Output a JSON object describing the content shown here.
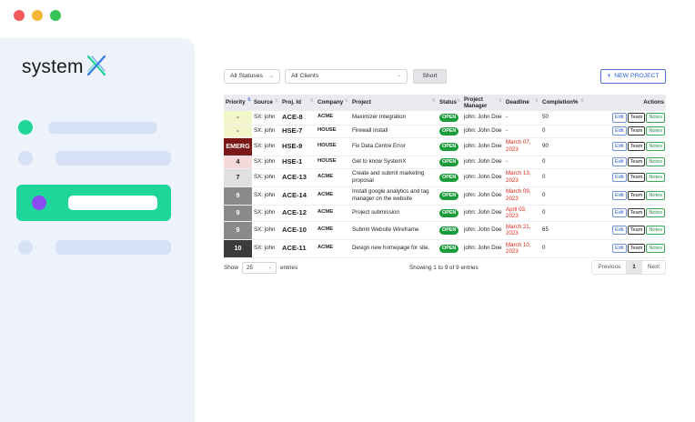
{
  "window": {
    "dots": [
      {
        "name": "close-dot",
        "color": "#f05a5a"
      },
      {
        "name": "minimize-dot",
        "color": "#f6b636"
      },
      {
        "name": "maximize-dot",
        "color": "#38c457"
      }
    ]
  },
  "sidebar": {
    "logo_text": "system",
    "logo_colors": {
      "left": "#1fd69a",
      "right": "#2f7de0"
    },
    "bullets": {
      "green": "#1fd69a",
      "purple": "#8a4cf0",
      "pale": "#d7e1f5"
    }
  },
  "filters": {
    "status_select": "All Statuses",
    "clients_select": "All Clients",
    "short_button": "Short",
    "new_project_button": "NEW PROJECT"
  },
  "table": {
    "headers": {
      "priority": "Priority",
      "source": "Source",
      "proj_id": "Proj. Id",
      "company": "Company",
      "project": "Project",
      "status": "Status",
      "pm": "Project Manager",
      "deadline": "Deadline",
      "completion": "Completion%",
      "actions": "Actions"
    },
    "action_labels": {
      "edit": "Edit",
      "team": "Team",
      "notes": "Notes"
    },
    "rows": [
      {
        "priority": "-",
        "priority_bg": "#f2f6c8",
        "priority_color": "#222",
        "source": "SX: john",
        "proj_id": "ACE-8",
        "company": "ACME",
        "project": "Maximizer Integration",
        "status": "OPEN",
        "pm": "john: John Doe",
        "deadline": "-",
        "deadline_red": false,
        "completion": "50"
      },
      {
        "priority": "-",
        "priority_bg": "#f2f6c8",
        "priority_color": "#222",
        "source": "SX: john",
        "proj_id": "HSE-7",
        "company": "HOUSE",
        "project": "Firewall Install",
        "status": "OPEN",
        "pm": "john: John Doe",
        "deadline": "-",
        "deadline_red": false,
        "completion": "0"
      },
      {
        "priority": "EMERG",
        "priority_bg": "#7b1717",
        "priority_color": "#ffffff",
        "source": "SX: john",
        "proj_id": "HSE-9",
        "company": "HOUSE",
        "project": "Fix Data Centre Error",
        "status": "OPEN",
        "pm": "john: John Doe",
        "deadline": "March 07, 2023",
        "deadline_red": true,
        "completion": "90"
      },
      {
        "priority": "4",
        "priority_bg": "#f6dada",
        "priority_color": "#222",
        "source": "SX: john",
        "proj_id": "HSE-1",
        "company": "HOUSE",
        "project": "Get to know SystemX",
        "status": "OPEN",
        "pm": "john: John Doe",
        "deadline": "-",
        "deadline_red": false,
        "completion": "0"
      },
      {
        "priority": "7",
        "priority_bg": "#e0e0e0",
        "priority_color": "#222",
        "source": "SX: john",
        "proj_id": "ACE-13",
        "company": "ACME",
        "project": "Create and submit marketing proposal",
        "status": "OPEN",
        "pm": "john: John Doe",
        "deadline": "March 13, 2023",
        "deadline_red": true,
        "completion": "0"
      },
      {
        "priority": "9",
        "priority_bg": "#8a8a8a",
        "priority_color": "#ffffff",
        "source": "SX: john",
        "proj_id": "ACE-14",
        "company": "ACME",
        "project": "Install google analytics and tag manager on the website",
        "status": "OPEN",
        "pm": "john: John Doe",
        "deadline": "March 09, 2023",
        "deadline_red": true,
        "completion": "0"
      },
      {
        "priority": "9",
        "priority_bg": "#8a8a8a",
        "priority_color": "#ffffff",
        "source": "SX: john",
        "proj_id": "ACE-12",
        "company": "ACME",
        "project": "Project submission",
        "status": "OPEN",
        "pm": "john: John Doe",
        "deadline": "April 03, 2023",
        "deadline_red": true,
        "completion": "0"
      },
      {
        "priority": "9",
        "priority_bg": "#8a8a8a",
        "priority_color": "#ffffff",
        "source": "SX: john",
        "proj_id": "ACE-10",
        "company": "ACME",
        "project": "Submit Website Wireframe",
        "status": "OPEN",
        "pm": "john: John Doe",
        "deadline": "March 21, 2023",
        "deadline_red": true,
        "completion": "65"
      },
      {
        "priority": "10",
        "priority_bg": "#3b3b3b",
        "priority_color": "#ffffff",
        "source": "SX: john",
        "proj_id": "ACE-11",
        "company": "ACME",
        "project": "Design new homepage for site.",
        "status": "OPEN",
        "pm": "john: John Doe",
        "deadline": "March 10, 2023",
        "deadline_red": true,
        "completion": "0"
      }
    ]
  },
  "footer": {
    "show_label": "Show",
    "page_size": "25",
    "entries_label": "entries",
    "info": "Showing 1 to 9 of 9 entries",
    "previous": "Previous",
    "current_page": "1",
    "next": "Next"
  }
}
